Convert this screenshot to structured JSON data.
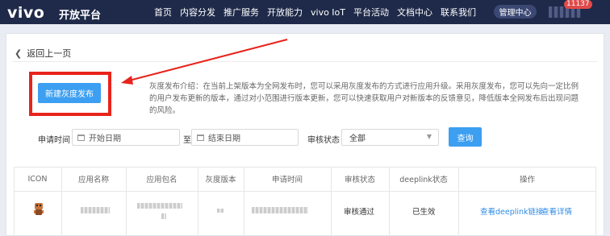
{
  "header": {
    "logo": "vivo",
    "logo_sub": "开放平台",
    "nav": [
      "首页",
      "内容分发",
      "推广服务",
      "开放能力",
      "vivo IoT",
      "平台活动",
      "文档中心",
      "联系我们"
    ],
    "mgmt_label": "管理中心",
    "badge_count": "11137"
  },
  "page": {
    "back_label": "返回上一页",
    "new_button": "新建灰度发布",
    "intro_text": "灰度发布介绍：在当前上架版本为全网发布时，您可以采用灰度发布的方式进行应用升级。采用灰度发布，您可以先向一定比例的用户发布更新的版本，通过对小范围进行版本更新，您可以快速获取用户对新版本的反馈意见，降低版本全网发布后出现问题的风险。"
  },
  "filters": {
    "apply_time_label": "申请时间",
    "start_placeholder": "开始日期",
    "separator": "至",
    "end_placeholder": "结束日期",
    "status_label": "审核状态",
    "status_value": "全部",
    "query_label": "查询"
  },
  "table": {
    "headers": [
      "ICON",
      "应用名称",
      "应用包名",
      "灰度版本",
      "申请时间",
      "审核状态",
      "deeplink状态",
      "操作"
    ],
    "rows": [
      {
        "status": "审核通过",
        "deeplink_status": "已生效",
        "action_deeplink": "查看deeplink链接",
        "action_detail": "查看详情"
      }
    ]
  },
  "colors": {
    "nav_bg": "#1f2a4a",
    "primary": "#3d9ff1",
    "highlight_box": "#e8231c",
    "link": "#2f8be6"
  }
}
